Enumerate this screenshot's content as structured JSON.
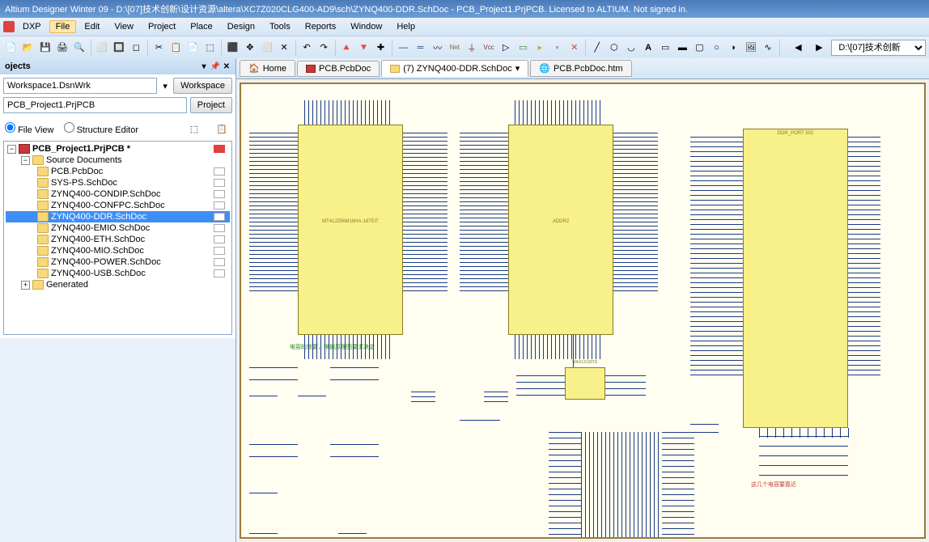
{
  "title": "Altium Designer Winter 09 - D:\\[07]技术创新\\设计资源\\altera\\XC7Z020CLG400-AD9\\sch\\ZYNQ400-DDR.SchDoc - PCB_Project1.PrjPCB. Licensed to ALTIUM. Not signed in.",
  "menu": {
    "dxp": "DXP",
    "file": "File",
    "edit": "Edit",
    "view": "View",
    "project": "Project",
    "place": "Place",
    "design": "Design",
    "tools": "Tools",
    "reports": "Reports",
    "window": "Window",
    "help": "Help"
  },
  "toolbar_right": "D:\\[07]技术创新",
  "projects_panel": {
    "title": "ojects",
    "workspace": "Workspace1.DsnWrk",
    "workspace_btn": "Workspace",
    "project": "PCB_Project1.PrjPCB",
    "project_btn": "Project",
    "radio_file": "File View",
    "radio_struct": "Structure Editor"
  },
  "tree": {
    "root": "PCB_Project1.PrjPCB *",
    "src": "Source Documents",
    "docs": [
      "PCB.PcbDoc",
      "SYS-PS.SchDoc",
      "ZYNQ400-CONDIP.SchDoc",
      "ZYNQ400-CONFPC.SchDoc",
      "ZYNQ400-DDR.SchDoc",
      "ZYNQ400-EMIO.SchDoc",
      "ZYNQ400-ETH.SchDoc",
      "ZYNQ400-MIO.SchDoc",
      "ZYNQ400-POWER.SchDoc",
      "ZYNQ400-USB.SchDoc"
    ],
    "gen": "Generated"
  },
  "tabs": {
    "home": "Home",
    "pcb": "PCB.PcbDoc",
    "zynq": "(7) ZYNQ400-DDR.SchDoc",
    "htm": "PCB.PcbDoc.htm"
  },
  "schematic": {
    "chip1": "MT41J256M16HA-187EIT",
    "chip2": "ADDR2",
    "chip3": "DDR_PORT 502",
    "chip4": "MAX13130TE",
    "note1": "电容的放置，根据原理图要求决定",
    "note2": "这几个电容要靠近"
  }
}
